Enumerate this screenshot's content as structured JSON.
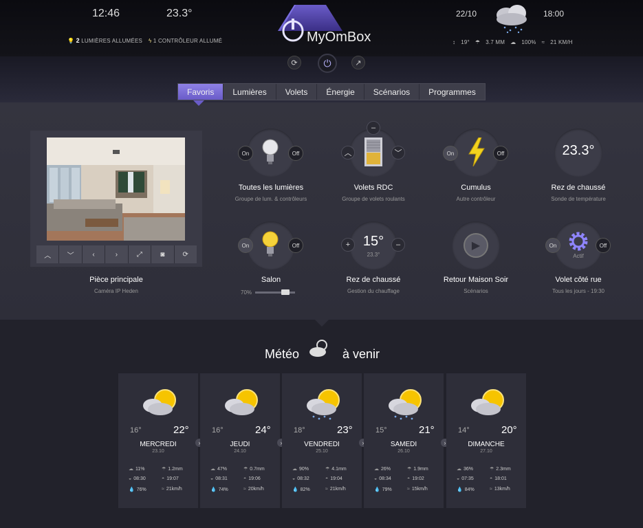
{
  "header": {
    "time_left": "12:46",
    "temp": "23.3°",
    "date": "22/10",
    "time_right": "18:00",
    "lights_count": "2",
    "lights_text": "LUMIÈRES ALLUMÉES",
    "controllers_text": "1 CONTRÔLEUR ALLUMÉ",
    "brand": "MyOmBox",
    "w_temp": "19°",
    "w_rain": "3.7 MM",
    "w_humidity": "100%",
    "w_wind": "21 KM/H",
    "colors": {
      "accent": "#7b6ee0",
      "brand_glow": "#8f85ff"
    }
  },
  "tabs": [
    "Favoris",
    "Lumières",
    "Volets",
    "Énergie",
    "Scénarios",
    "Programmes"
  ],
  "camera": {
    "title": "Pièce principale",
    "subtitle": "Caméra IP Heden"
  },
  "devices": [
    {
      "title": "Toutes les lumières",
      "subtitle": "Groupe de lum. & contrôleurs",
      "on": "On",
      "off": "Off",
      "icon": "bulb-off-icon"
    },
    {
      "title": "Volets RDC",
      "subtitle": "Groupe de volets roulants",
      "icon": "shutter-icon"
    },
    {
      "title": "Cumulus",
      "subtitle": "Autre contrôleur",
      "on": "On",
      "off": "Off",
      "icon": "lightning-icon"
    },
    {
      "title": "Rez de chaussé",
      "subtitle": "Sonde de température",
      "value": "23.3°"
    },
    {
      "title": "Salon",
      "subtitle": "",
      "on": "On",
      "off": "Off",
      "icon": "bulb-on-icon",
      "level": "70%"
    },
    {
      "title": "Rez de chaussé",
      "subtitle": "Gestion du chauffage",
      "value": "15°",
      "subvalue": "23.3°"
    },
    {
      "title": "Retour Maison Soir",
      "subtitle": "Scénarios",
      "icon": "play-icon"
    },
    {
      "title": "Volet côté rue",
      "subtitle": "Tous les jours - 19:30",
      "on": "On",
      "off": "Off",
      "state": "Actif",
      "icon": "gear-icon"
    }
  ],
  "weather": {
    "title_left": "Météo",
    "title_right": "à venir",
    "days": [
      {
        "name": "MERCREDI",
        "date": "23.10",
        "min": "16°",
        "max": "22°",
        "clouds": "11%",
        "rain": "1.2mm",
        "sunrise": "08:30",
        "sunset": "19:07",
        "humidity": "76%",
        "wind": "21km/h"
      },
      {
        "name": "JEUDI",
        "date": "24.10",
        "min": "16°",
        "max": "24°",
        "clouds": "47%",
        "rain": "0.7mm",
        "sunrise": "08:31",
        "sunset": "19:06",
        "humidity": "74%",
        "wind": "20km/h"
      },
      {
        "name": "VENDREDI",
        "date": "25.10",
        "min": "18°",
        "max": "23°",
        "clouds": "90%",
        "rain": "4.1mm",
        "sunrise": "08:32",
        "sunset": "19:04",
        "humidity": "82%",
        "wind": "21km/h"
      },
      {
        "name": "SAMEDI",
        "date": "26.10",
        "min": "15°",
        "max": "21°",
        "clouds": "26%",
        "rain": "1.9mm",
        "sunrise": "08:34",
        "sunset": "19:02",
        "humidity": "79%",
        "wind": "15km/h"
      },
      {
        "name": "DIMANCHE",
        "date": "27.10",
        "min": "14°",
        "max": "20°",
        "clouds": "36%",
        "rain": "2.3mm",
        "sunrise": "07:35",
        "sunset": "18:01",
        "humidity": "84%",
        "wind": "13km/h"
      }
    ]
  }
}
